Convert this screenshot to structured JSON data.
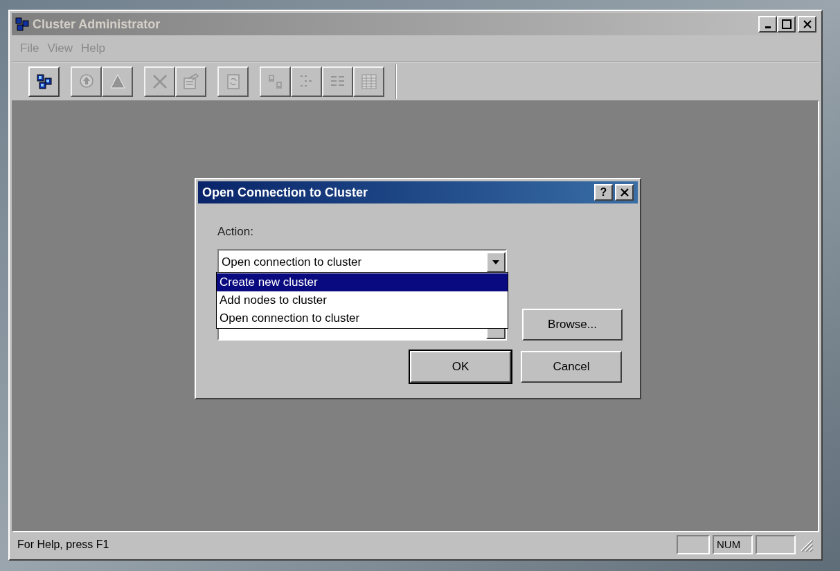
{
  "window": {
    "title": "Cluster Administrator",
    "active": false
  },
  "menu": [
    {
      "label": "File"
    },
    {
      "label": "View"
    },
    {
      "label": "Help"
    }
  ],
  "toolbar": [
    [
      {
        "kind": "cluster",
        "disabled": false
      }
    ],
    [
      {
        "kind": "online",
        "disabled": true
      },
      {
        "kind": "offline",
        "disabled": true
      }
    ],
    [
      {
        "kind": "delete",
        "disabled": true
      },
      {
        "kind": "properties",
        "disabled": true
      }
    ],
    [
      {
        "kind": "refresh",
        "disabled": true
      }
    ],
    [
      {
        "kind": "largeicons",
        "disabled": true
      },
      {
        "kind": "smallicons",
        "disabled": true
      },
      {
        "kind": "list",
        "disabled": true
      },
      {
        "kind": "details",
        "disabled": true
      }
    ]
  ],
  "dialog": {
    "title": "Open Connection to Cluster",
    "active": true,
    "help": "?",
    "action_label": "Action:",
    "action_value": "Open connection to cluster",
    "options": [
      {
        "label": "Create new cluster",
        "selected": true
      },
      {
        "label": "Add nodes to cluster",
        "selected": false
      },
      {
        "label": "Open connection to cluster",
        "selected": false
      }
    ],
    "buttons": [
      {
        "label": "Browse...",
        "default": false
      },
      {
        "label": "OK",
        "default": true
      },
      {
        "label": "Cancel",
        "default": false
      }
    ]
  },
  "status_bar": {
    "text": "For Help, press F1",
    "num": "NUM"
  }
}
